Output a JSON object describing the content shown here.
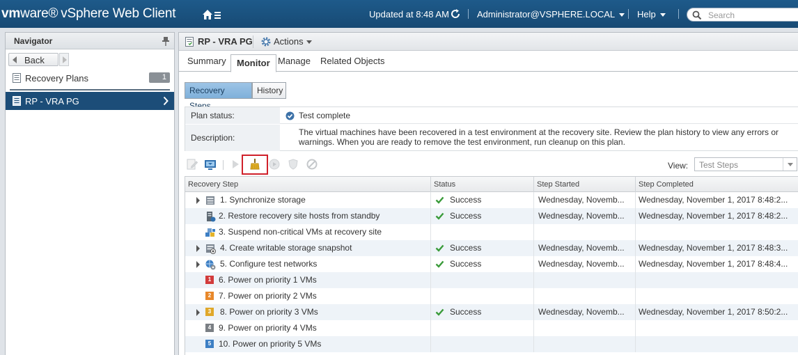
{
  "topbar": {
    "brand_vm": "vm",
    "brand_ware": "ware®",
    "brand_product": "vSphere Web Client",
    "updated": "Updated at 8:48 AM",
    "user": "Administrator@VSPHERE.LOCAL",
    "help": "Help",
    "search_placeholder": "Search"
  },
  "navigator": {
    "title": "Navigator",
    "back_label": "Back",
    "items": [
      {
        "label": "Recovery Plans",
        "count": "1"
      }
    ],
    "selected": {
      "label": "RP - VRA PG"
    }
  },
  "object": {
    "title": "RP - VRA PG",
    "actions_label": "Actions"
  },
  "tabs": [
    {
      "label": "Summary"
    },
    {
      "label": "Monitor"
    },
    {
      "label": "Manage"
    },
    {
      "label": "Related Objects"
    }
  ],
  "subtabs": [
    {
      "label": "Recovery Steps"
    },
    {
      "label": "History"
    }
  ],
  "plan": {
    "status_label": "Plan status:",
    "status_value": "Test complete",
    "description_label": "Description:",
    "description_value": "The virtual machines have been recovered in a test environment at the recovery site. Review the plan history to view any errors or warnings. When you are ready to remove the test environment, run cleanup on this plan."
  },
  "toolbar": {
    "view_label": "View:",
    "view_value": "Test Steps"
  },
  "grid": {
    "columns": [
      "Recovery Step",
      "Status",
      "Step Started",
      "Step Completed"
    ],
    "rows": [
      {
        "step": "1. Synchronize storage",
        "status": "Success",
        "started": "Wednesday, Novemb...",
        "completed": "Wednesday, November 1, 2017 8:48:2...",
        "icon": "storage-icon",
        "expandable": true
      },
      {
        "step": "2. Restore recovery site hosts from standby",
        "status": "Success",
        "started": "Wednesday, Novemb...",
        "completed": "Wednesday, November 1, 2017 8:48:2...",
        "icon": "host-icon",
        "expandable": false
      },
      {
        "step": "3. Suspend non-critical VMs at recovery site",
        "status": "",
        "started": "",
        "completed": "",
        "icon": "vms-icon",
        "expandable": false
      },
      {
        "step": "4. Create writable storage snapshot",
        "status": "Success",
        "started": "Wednesday, Novemb...",
        "completed": "Wednesday, November 1, 2017 8:48:3...",
        "icon": "snapshot-icon",
        "expandable": true
      },
      {
        "step": "5. Configure test networks",
        "status": "Success",
        "started": "Wednesday, Novemb...",
        "completed": "Wednesday, November 1, 2017 8:48:4...",
        "icon": "network-icon",
        "expandable": true
      },
      {
        "step": "6. Power on priority 1 VMs",
        "status": "",
        "started": "",
        "completed": "",
        "icon": "priority-icon",
        "priority": "1",
        "expandable": false
      },
      {
        "step": "7. Power on priority 2 VMs",
        "status": "",
        "started": "",
        "completed": "",
        "icon": "priority-icon",
        "priority": "2",
        "expandable": false
      },
      {
        "step": "8. Power on priority 3 VMs",
        "status": "Success",
        "started": "Wednesday, Novemb...",
        "completed": "Wednesday, November 1, 2017 8:50:2...",
        "icon": "priority-icon",
        "priority": "3",
        "expandable": true
      },
      {
        "step": "9. Power on priority 4 VMs",
        "status": "",
        "started": "",
        "completed": "",
        "icon": "priority-icon",
        "priority": "4",
        "expandable": false
      },
      {
        "step": "10. Power on priority 5 VMs",
        "status": "",
        "started": "",
        "completed": "",
        "icon": "priority-icon",
        "priority": "5",
        "expandable": false
      }
    ]
  },
  "colors": {
    "topbar": "#1e5a8a",
    "selected_nav": "#1c4d78",
    "success": "#3a9b3a",
    "highlight": "#d0202a",
    "priority_1": "#d23b3b",
    "priority_2": "#e8882a",
    "priority_3": "#e0a82a",
    "priority_4": "#7a7f84",
    "priority_5": "#3d7fc4"
  }
}
